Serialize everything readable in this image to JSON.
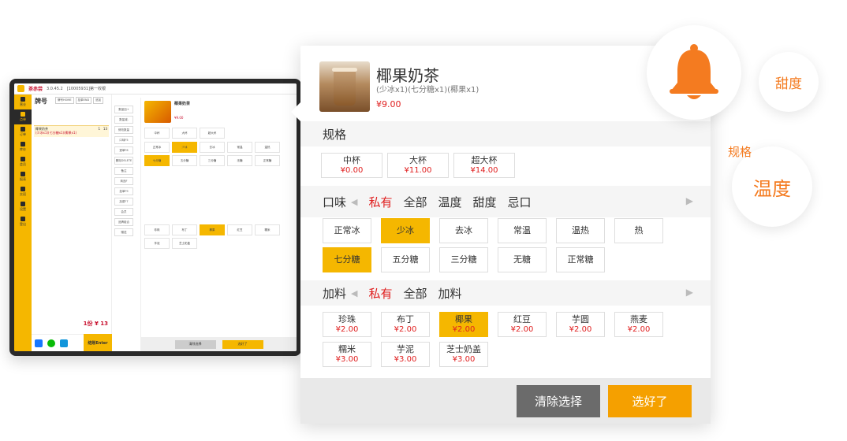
{
  "tablet": {
    "brand": "茶赤尝",
    "version": "3.0.45.2",
    "store": "[10005931]第一收银",
    "order_title": "牌号",
    "order_btns": [
      "牌号HOME",
      "挂单END",
      "追加"
    ],
    "order_item": "椰果奶茶",
    "order_item_detail": "(少冰x1)(七分糖x1)(椰果x1)",
    "order_qty": "1",
    "order_amount": "13",
    "total": "1份 ¥ 13",
    "enter": "结账Enter",
    "sidebar": [
      "营业",
      "点单",
      "订单",
      "库存",
      "会员",
      "报表",
      "交班",
      "设置",
      "登出"
    ],
    "tools": [
      "数量加+",
      "数量减-",
      "修改数量",
      "口味F5",
      "退单F6",
      "删除DELETE",
      "备注",
      "商品F",
      "挂单F9",
      "加菜F7",
      "会员",
      "品牌组合",
      "赠送"
    ],
    "panel_name": "椰果奶茶",
    "panel_price": "¥9.00",
    "size_chips": [
      "中杯",
      "大杯",
      "超大杯"
    ],
    "flavor_chips": [
      "正常冰",
      "少冰",
      "去冰",
      "常温",
      "温热",
      "七分糖",
      "五分糖",
      "三分糖",
      "无糖",
      "正常糖"
    ],
    "topping_chips": [
      "珍珠",
      "布丁",
      "椰果",
      "红豆",
      "糯米",
      "芋泥",
      "芝士奶盖"
    ],
    "clear": "清除选择",
    "ok": "选好了"
  },
  "dialog": {
    "product_name": "椰果奶茶",
    "product_spec": "(少冰x1)(七分糖x1)(椰果x1)",
    "product_price": "¥9.00",
    "spec_title": "规格",
    "sizes": [
      {
        "name": "中杯",
        "price": "¥0.00",
        "selected": false
      },
      {
        "name": "大杯",
        "price": "¥11.00",
        "selected": false
      },
      {
        "name": "超大杯",
        "price": "¥14.00",
        "selected": false
      }
    ],
    "flavor_label": "口味",
    "flavor_tabs": [
      "私有",
      "全部",
      "温度",
      "甜度",
      "忌口"
    ],
    "flavor_active": "私有",
    "temperatures": [
      {
        "name": "正常冰",
        "selected": false
      },
      {
        "name": "少冰",
        "selected": true
      },
      {
        "name": "去冰",
        "selected": false
      },
      {
        "name": "常温",
        "selected": false
      },
      {
        "name": "温热",
        "selected": false
      },
      {
        "name": "热",
        "selected": false
      }
    ],
    "sweetness": [
      {
        "name": "七分糖",
        "selected": true
      },
      {
        "name": "五分糖",
        "selected": false
      },
      {
        "name": "三分糖",
        "selected": false
      },
      {
        "name": "无糖",
        "selected": false
      },
      {
        "name": "正常糖",
        "selected": false
      }
    ],
    "topping_label": "加料",
    "topping_tabs": [
      "私有",
      "全部",
      "加料"
    ],
    "topping_active": "私有",
    "toppings": [
      {
        "name": "珍珠",
        "price": "¥2.00",
        "selected": false
      },
      {
        "name": "布丁",
        "price": "¥2.00",
        "selected": false
      },
      {
        "name": "椰果",
        "price": "¥2.00",
        "selected": true
      },
      {
        "name": "红豆",
        "price": "¥2.00",
        "selected": false
      },
      {
        "name": "芋圆",
        "price": "¥2.00",
        "selected": false
      },
      {
        "name": "燕麦",
        "price": "¥2.00",
        "selected": false
      },
      {
        "name": "糯米",
        "price": "¥3.00",
        "selected": false
      },
      {
        "name": "芋泥",
        "price": "¥3.00",
        "selected": false
      },
      {
        "name": "芝士奶盖",
        "price": "¥3.00",
        "selected": false
      }
    ],
    "clear_label": "清除选择",
    "confirm_label": "选好了"
  },
  "bubbles": {
    "sweetness": "甜度",
    "spec": "规格",
    "temperature": "温度"
  },
  "colors": {
    "accent": "#f5b700",
    "price": "#e02020",
    "orange_text": "#f47b20",
    "clear_button": "#6b6b6b",
    "confirm_button": "#f5a000"
  },
  "icons": {
    "bell": "bell-icon",
    "chevron_left": "chevron-left-icon",
    "chevron_right": "chevron-right-icon"
  }
}
